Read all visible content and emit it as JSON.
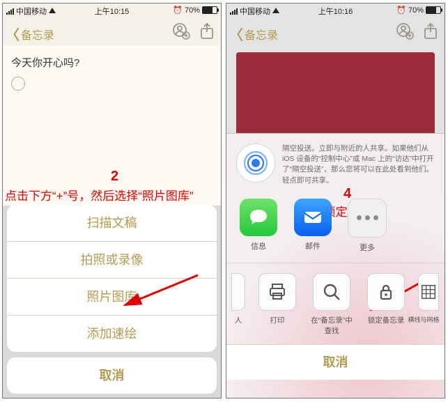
{
  "left": {
    "status": {
      "carrier": "中国移动",
      "time": "上午10:15",
      "battery": "70%",
      "alarm": "⏰"
    },
    "nav": {
      "back": "备忘录"
    },
    "note_text": "今天你开心吗?",
    "sheet": {
      "options": [
        "扫描文稿",
        "拍照或录像",
        "照片图库",
        "添加速绘"
      ],
      "cancel": "取消"
    },
    "overlay": {
      "num": "2",
      "text": "点击下方“+”号，然后选择“照片图库”"
    }
  },
  "right": {
    "status": {
      "carrier": "中国移动",
      "time": "上午10:16",
      "battery": "70%",
      "alarm": "⏰"
    },
    "nav": {
      "back": "备忘录"
    },
    "airdrop_text": "隔空投送。立即与附近的人共享。如果他们从 iOS 设备的“控制中心”或 Mac 上的“访达”中打开了“隔空投送”，那么您将可以在此处看到他们。轻点即可共享。",
    "apps": {
      "messages": "信息",
      "mail": "邮件",
      "more": "更多"
    },
    "actions": {
      "people": "人",
      "print": "打印",
      "find": "在“备忘录”中查找",
      "lock": "锁定备忘录",
      "grid": "横线与网格"
    },
    "cancel": "取消",
    "overlay": {
      "num": "4",
      "text": "选择“锁定备忘录”"
    }
  }
}
